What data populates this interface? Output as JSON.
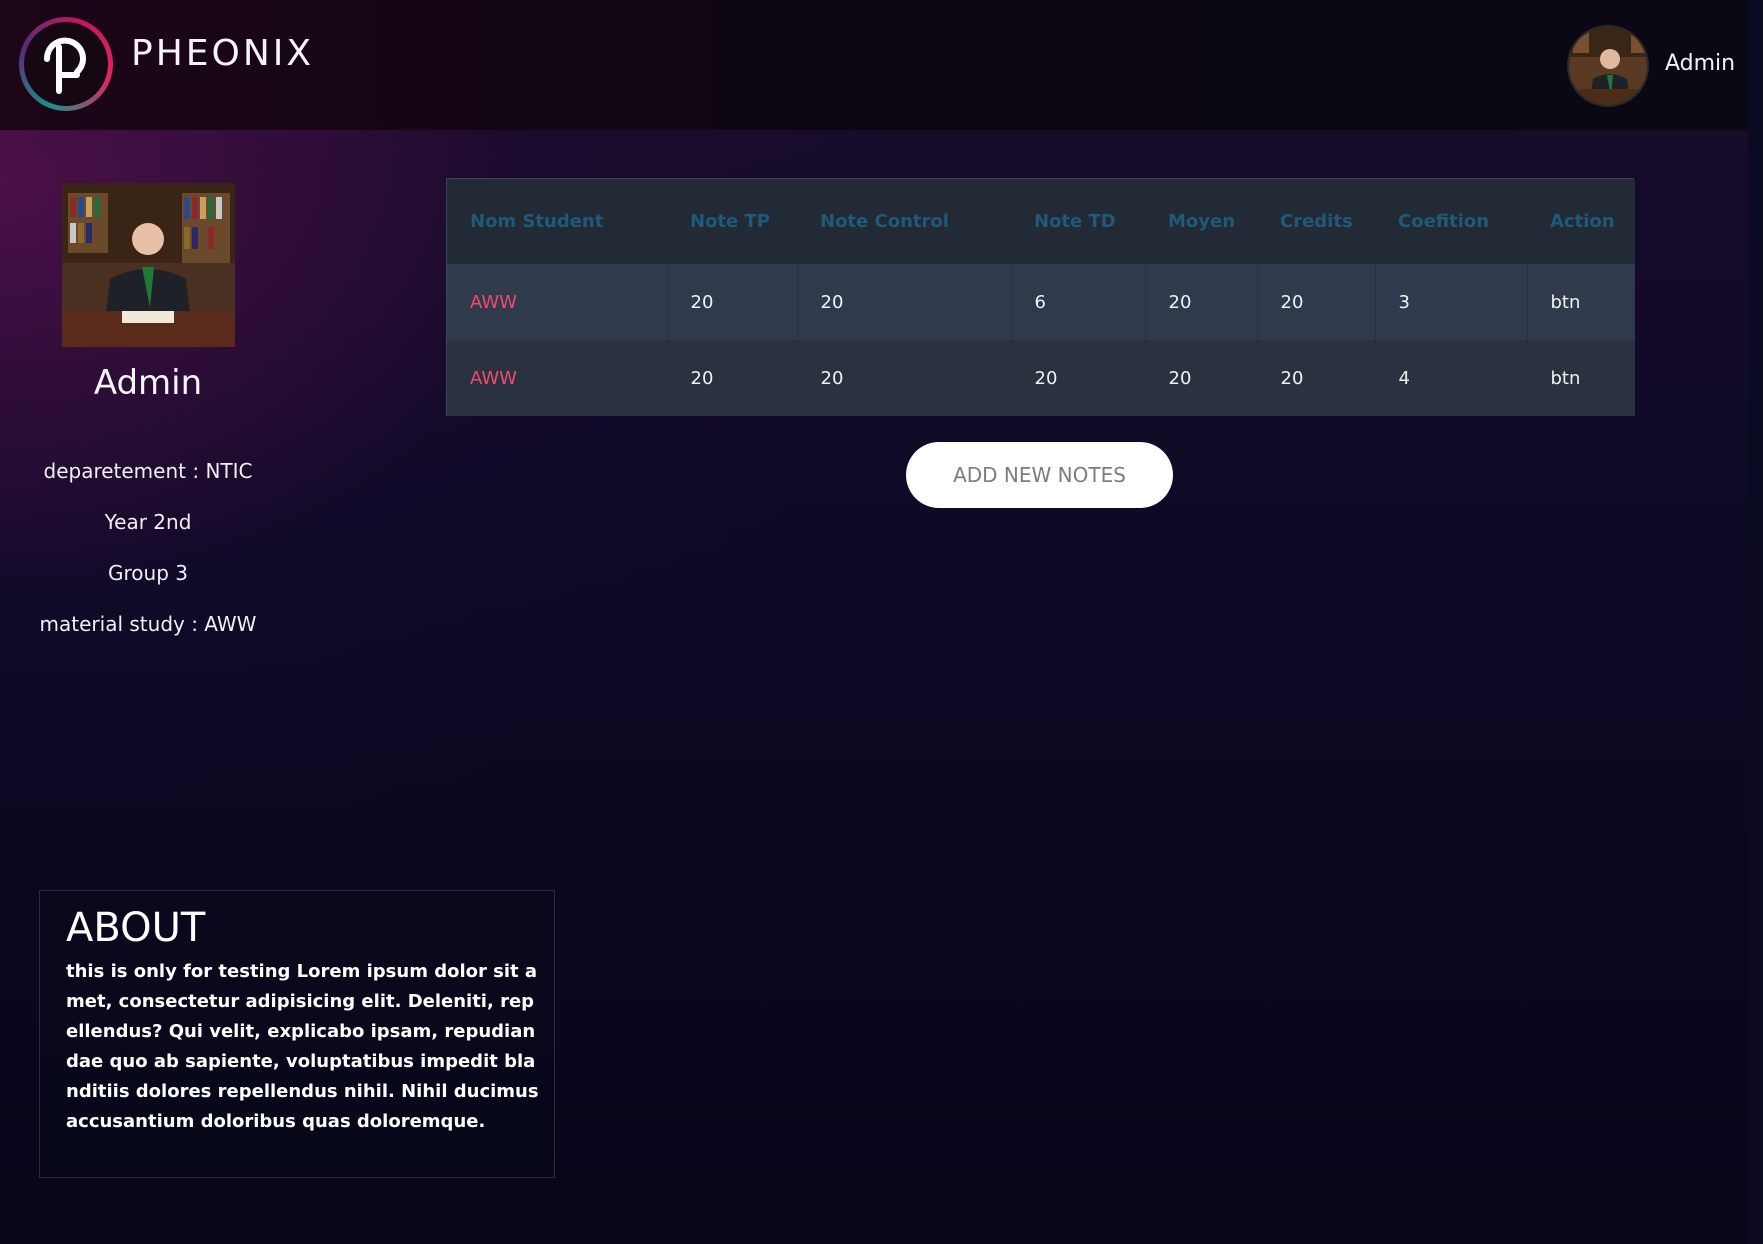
{
  "header": {
    "brand": "PHEONIX",
    "user_name": "Admin"
  },
  "profile": {
    "name": "Admin",
    "department": "deparetement : NTIC",
    "year": "Year 2nd",
    "group": "Group 3",
    "material": "material study : AWW"
  },
  "table": {
    "headers": [
      "Nom Student",
      "Note TP",
      "Note Control",
      "Note TD",
      "Moyen",
      "Credits",
      "Coefition",
      "Action"
    ],
    "rows": [
      [
        "AWW",
        "20",
        "20",
        "6",
        "20",
        "20",
        "3",
        "btn"
      ],
      [
        "AWW",
        "20",
        "20",
        "20",
        "20",
        "20",
        "4",
        "btn"
      ]
    ]
  },
  "add_button": "ADD NEW NOTES",
  "about": {
    "title": "ABOUT",
    "text": "this is only for testing Lorem ipsum dolor sit amet, consectetur adipisicing elit. Deleniti, repellendus? Qui velit, explicabo ipsam, repudiandae quo ab sapiente, voluptatibus impedit blanditiis dolores repellendus nihil. Nihil ducimus accusantium doloribus quas doloremque."
  },
  "colors": {
    "header_text": "#1f5a78",
    "student_name": "#ef4b6c",
    "table_bg": "#2b3340"
  },
  "icons": {
    "logo": "pheonix-logo-icon",
    "avatar": "admin-avatar"
  }
}
